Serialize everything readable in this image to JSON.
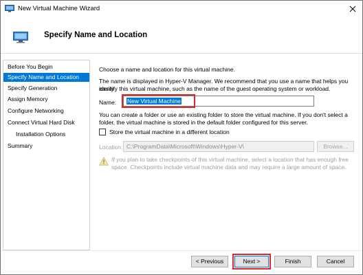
{
  "window": {
    "title": "New Virtual Machine Wizard"
  },
  "header": {
    "title": "Specify Name and Location"
  },
  "nav": {
    "items": [
      {
        "label": "Before You Begin"
      },
      {
        "label": "Specify Name and Location"
      },
      {
        "label": "Specify Generation"
      },
      {
        "label": "Assign Memory"
      },
      {
        "label": "Configure Networking"
      },
      {
        "label": "Connect Virtual Hard Disk"
      },
      {
        "label": "Installation Options"
      },
      {
        "label": "Summary"
      }
    ],
    "selected_index": 1
  },
  "content": {
    "intro": "Choose a name and location for this virtual machine.",
    "desc_line1": "The name is displayed in Hyper-V Manager. We recommend that you use a name that helps you easily",
    "desc_line2": "identify this virtual machine, such as the name of the guest operating system or workload.",
    "name_label": "Name:",
    "name_value": "New Virtual Machine",
    "folder_line1": "You can create a folder or use an existing folder to store the virtual machine. If you don't select a",
    "folder_line2": "folder, the virtual machine is stored in the default folder configured for this server.",
    "store_checkbox_label": "Store the virtual machine in a different location",
    "store_checked": false,
    "location_label": "Location:",
    "location_value": "C:\\ProgramData\\Microsoft\\Windows\\Hyper-V\\",
    "browse_label": "Browse...",
    "warning_line1": "If you plan to take checkpoints of this virtual machine, select a location that has enough free",
    "warning_line2": "space. Checkpoints include virtual machine data and may require a large amount of space."
  },
  "footer": {
    "previous_label": "< Previous",
    "next_label": "Next >",
    "finish_label": "Finish",
    "cancel_label": "Cancel"
  },
  "icons": {
    "window": "virtual-machine-icon",
    "header": "virtual-machine-icon",
    "close": "close-icon",
    "warning": "warning-icon"
  },
  "colors": {
    "selection": "#0078d7",
    "highlight_box": "#e0262a"
  }
}
